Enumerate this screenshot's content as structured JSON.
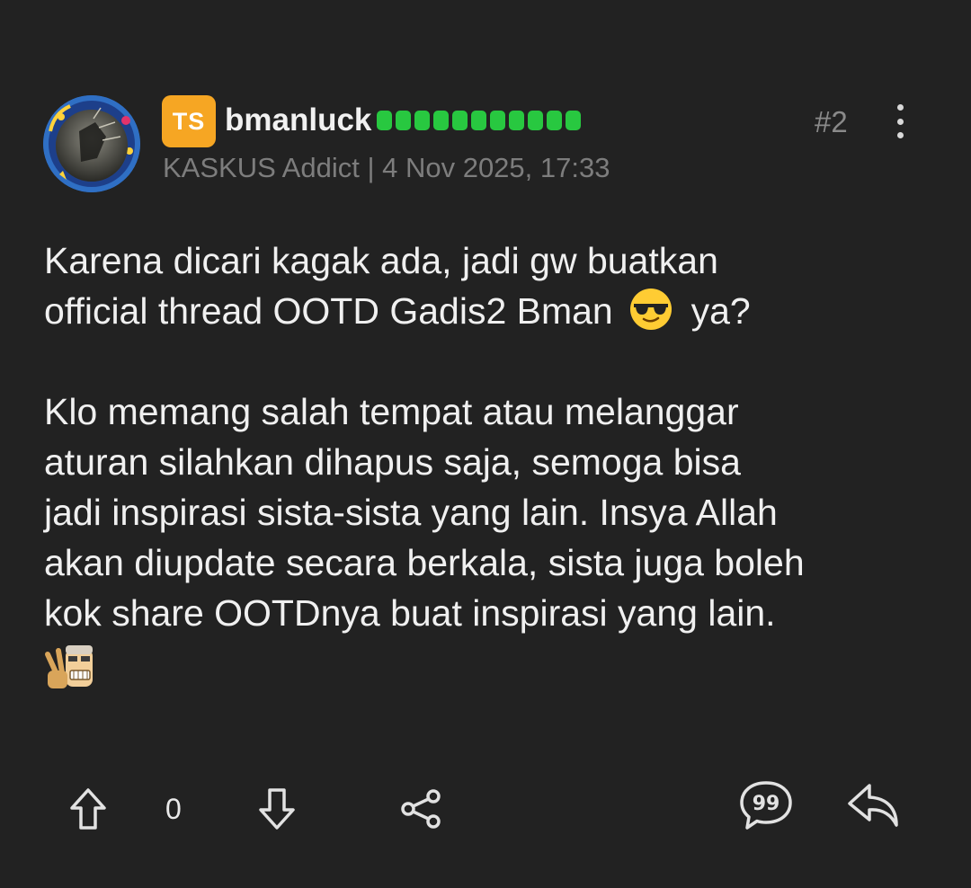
{
  "post": {
    "badge": "TS",
    "username": "bmanluck",
    "reputation_dots": 11,
    "post_number": "#2",
    "meta": "KASKUS Addict | 4 Nov 2025, 17:33",
    "body": {
      "line1": "Karena dicari kagak ada, jadi gw buatkan",
      "line2a": "official thread OOTD Gadis2 Bman",
      "line2b": "ya?",
      "line3": "Klo memang salah tempat atau melanggar",
      "line4": "aturan silahkan dihapus saja, semoga bisa",
      "line5": "jadi inspirasi sista-sista yang lain. Insya Allah",
      "line6": "akan diupdate secara berkala, sista juga boleh",
      "line7": "kok share OOTDnya buat inspirasi yang lain."
    },
    "vote_count": "0"
  },
  "icons": {
    "avatar": "avatar-image",
    "more": "more-vertical-icon",
    "cool_emoji": "sunglasses-emoji",
    "peace_emoticon": "peace-sign-emoticon",
    "upvote": "arrow-up-icon",
    "downvote": "arrow-down-icon",
    "share": "share-icon",
    "quote": "quote-bubble-icon",
    "reply": "reply-icon"
  },
  "colors": {
    "background": "#222222",
    "ts_badge": "#f6a623",
    "reputation": "#28c840",
    "muted_text": "#7d7d7d"
  }
}
